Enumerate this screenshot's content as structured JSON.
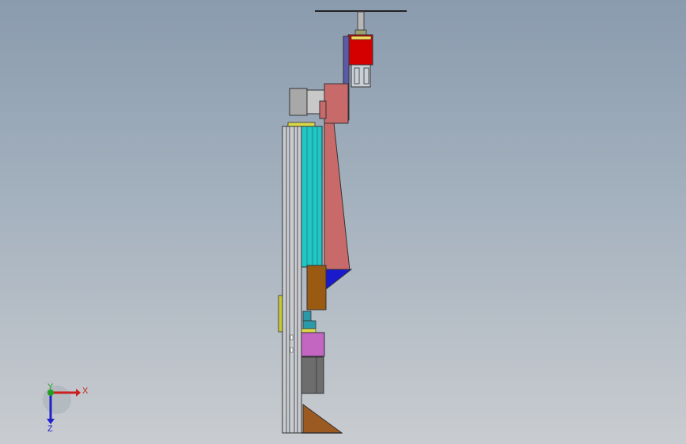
{
  "viewport": {
    "background_top": "#8a9bae",
    "background_bottom": "#c9ccd0"
  },
  "triad": {
    "x_label": "X",
    "y_label": "Y",
    "z_label": "Z",
    "x_color": "#cc2020",
    "y_color": "#20a020",
    "z_color": "#2020cc"
  },
  "assembly": {
    "colors": {
      "rail": "#c9ccd0",
      "cyan_block": "#22c6c6",
      "salmon_arm": "#c96a6a",
      "red_motor": "#d40000",
      "brown_block": "#9a5a12",
      "navy_wedge": "#1a1acc",
      "magenta_block": "#c266c2",
      "grey_block": "#6d6d6d",
      "yellow_plate": "#c8c83a",
      "teal_parts": "#2a9aa8",
      "purple_link": "#5a5aa8"
    }
  }
}
